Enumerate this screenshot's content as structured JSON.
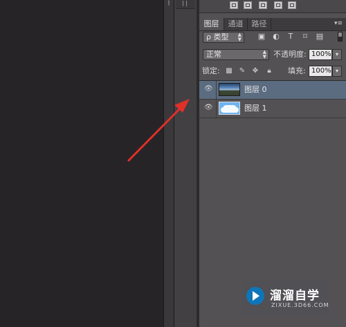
{
  "tabs": {
    "layers": "图层",
    "channels": "通道",
    "paths": "路径"
  },
  "filter": {
    "kind_label": "ρ 类型",
    "icons": [
      "image-filter-icon",
      "adjustment-filter-icon",
      "type-filter-icon",
      "shape-filter-icon",
      "smart-object-filter-icon"
    ]
  },
  "blend": {
    "mode": "正常",
    "opacity_label": "不透明度:",
    "opacity_value": "100%"
  },
  "lock": {
    "label": "锁定:",
    "fill_label": "填充:",
    "fill_value": "100%"
  },
  "layers": [
    {
      "name": "图层 0",
      "selected": true,
      "thumb": "landscape"
    },
    {
      "name": "图层 1",
      "selected": false,
      "thumb": "cloud"
    }
  ],
  "watermark": {
    "title": "溜溜自学",
    "url": "ZIXUE.3D66.COM"
  },
  "colors": {
    "selected_row": "#5b6b80",
    "annotation_arrow": "#e0302a",
    "panel_bg": "#535153",
    "canvas_bg": "#262426"
  }
}
